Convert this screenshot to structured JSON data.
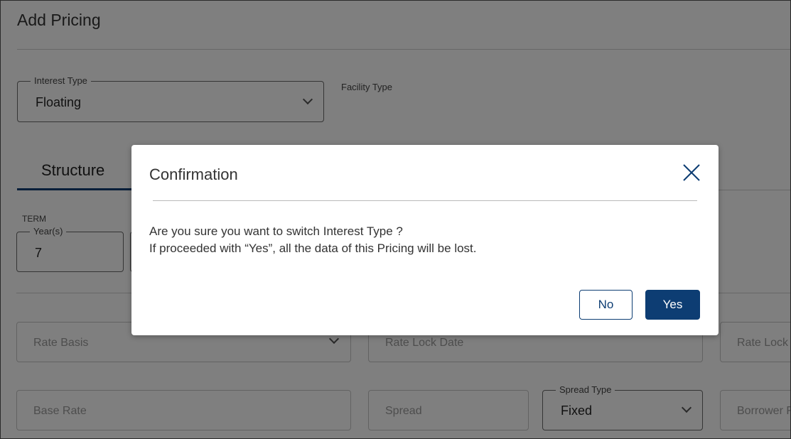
{
  "page": {
    "title": "Add Pricing",
    "interest_type": {
      "label": "Interest Type",
      "value": "Floating"
    },
    "facility_type": {
      "label": "Facility Type"
    },
    "tabs": [
      {
        "label": "Structure"
      }
    ],
    "term": {
      "label": "TERM",
      "years_label": "Year(s)",
      "years_value": "7"
    },
    "rate_basis": {
      "placeholder": "Rate Basis"
    },
    "rate_lock_date": {
      "placeholder": "Rate Lock Date"
    },
    "rate_lock_other": {
      "placeholder": "Rate Lock I"
    },
    "base_rate": {
      "placeholder": "Base Rate"
    },
    "spread": {
      "placeholder": "Spread"
    },
    "spread_type": {
      "label": "Spread Type",
      "value": "Fixed"
    },
    "borrower": {
      "placeholder": "Borrower F"
    }
  },
  "modal": {
    "title": "Confirmation",
    "message_line1": "Are you sure you want to switch Interest Type ?",
    "message_line2": "If proceeded with “Yes”, all the data of this Pricing will be lost.",
    "no_label": "No",
    "yes_label": "Yes"
  },
  "colors": {
    "primary": "#0d3d73",
    "overlay": "rgba(0,0,0,0.5)"
  }
}
